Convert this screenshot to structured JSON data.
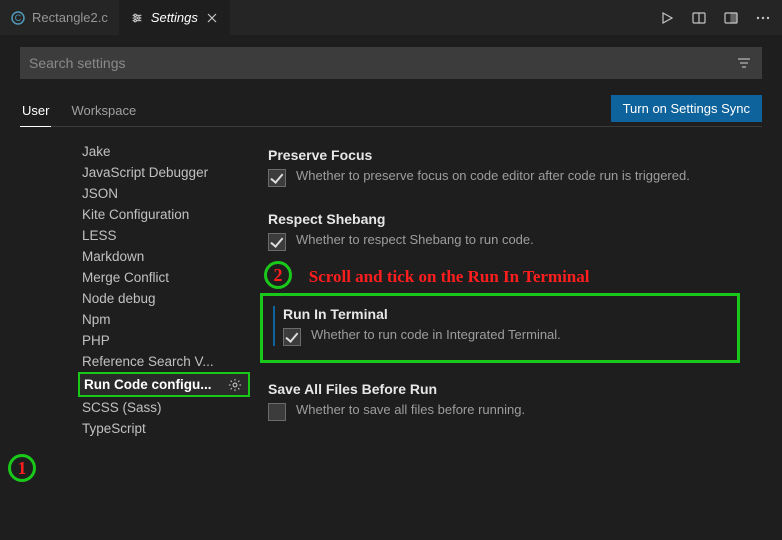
{
  "tabs": {
    "inactive": {
      "label": "Rectangle2.c"
    },
    "active": {
      "label": "Settings"
    }
  },
  "search": {
    "placeholder": "Search settings"
  },
  "scopes": {
    "user": "User",
    "workspace": "Workspace"
  },
  "sync_button": "Turn on Settings Sync",
  "sidebar": {
    "items": [
      "Jake",
      "JavaScript Debugger",
      "JSON",
      "Kite Configuration",
      "LESS",
      "Markdown",
      "Merge Conflict",
      "Node debug",
      "Npm",
      "PHP",
      "Reference Search V...",
      "Run Code configu...",
      "SCSS (Sass)",
      "TypeScript"
    ]
  },
  "settings": {
    "preserveFocus": {
      "title": "Preserve Focus",
      "desc": "Whether to preserve focus on code editor after code run is triggered.",
      "checked": true
    },
    "respectShebang": {
      "title": "Respect Shebang",
      "desc": "Whether to respect Shebang to run code.",
      "checked": true
    },
    "runInTerminal": {
      "title": "Run In Terminal",
      "desc": "Whether to run code in Integrated Terminal.",
      "checked": true
    },
    "saveAll": {
      "title": "Save All Files Before Run",
      "desc": "Whether to save all files before running.",
      "checked": false
    }
  },
  "annotations": {
    "step1": "1",
    "step2": "2",
    "step2_text": "Scroll and tick on the Run In Terminal"
  }
}
